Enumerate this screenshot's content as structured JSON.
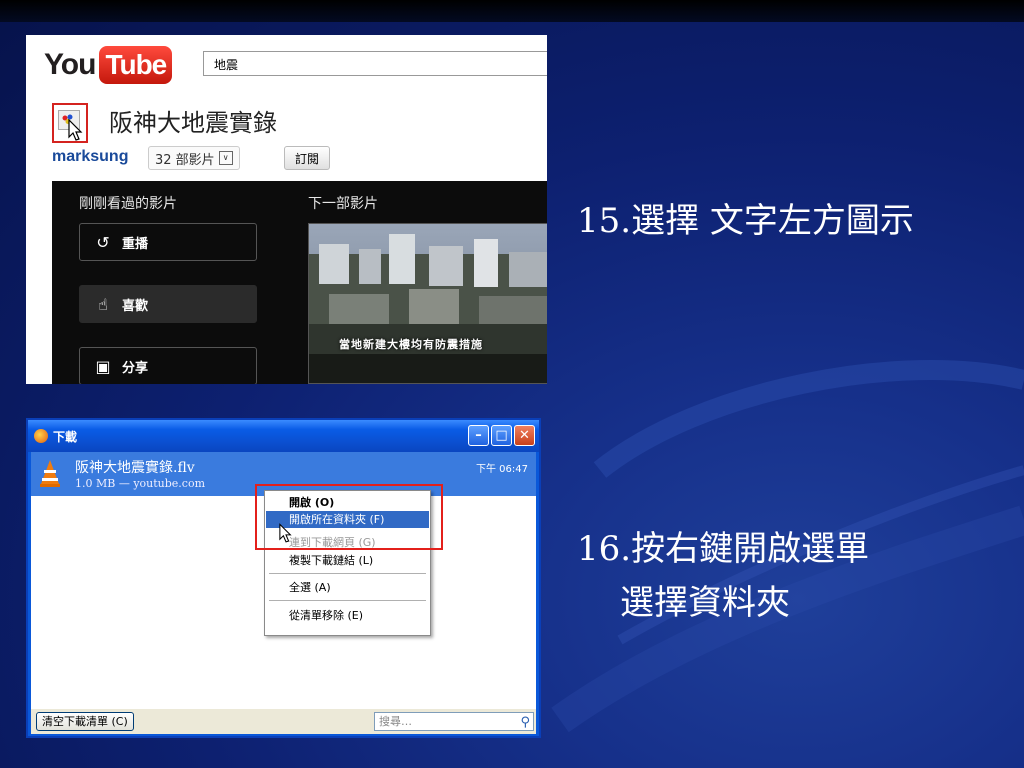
{
  "youtube": {
    "logo_you": "You",
    "logo_tube": "Tube",
    "search_value": "地震",
    "channel_title": "阪神大地震實錄",
    "username": "marksung",
    "videos_count": "32 部影片",
    "subscribe_label": "訂閱",
    "recently_watched": "剛剛看過的影片",
    "next_video": "下一部影片",
    "replay_label": "重播",
    "like_label": "喜歡",
    "share_label": "分享",
    "video_subtitle": "當地新建大樓均有防震措施"
  },
  "step15": "15.選擇 文字左方圖示",
  "step16_line1": "16.按右鍵開啟選單",
  "step16_line2": "選擇資料夾",
  "download_window": {
    "title": "下載",
    "file_name": "阪神大地震實錄.flv",
    "file_meta": "1.0 MB — youtube.com",
    "time": "下午 06:47",
    "menu": {
      "open": "開啟 (O)",
      "open_folder": "開啟所在資料夾 (F)",
      "go_to_page": "連到下載網頁 (G)",
      "copy_link": "複製下載鏈結 (L)",
      "select_all": "全選 (A)",
      "remove": "從清單移除 (E)"
    },
    "clear_button": "清空下載清單 (C)",
    "search_placeholder": "搜尋…"
  }
}
